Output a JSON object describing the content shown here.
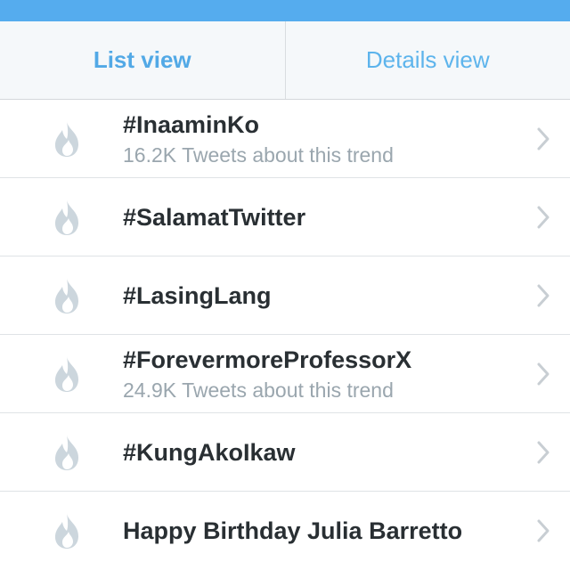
{
  "tabs": [
    {
      "label": "List view",
      "active": true
    },
    {
      "label": "Details view",
      "active": false
    }
  ],
  "trends": [
    {
      "name": "#InaaminKo",
      "count": "16.2K Tweets about this trend"
    },
    {
      "name": "#SalamatTwitter",
      "count": ""
    },
    {
      "name": "#LasingLang",
      "count": ""
    },
    {
      "name": "#ForevermoreProfessorX",
      "count": "24.9K Tweets about this trend"
    },
    {
      "name": "#KungAkoIkaw",
      "count": ""
    },
    {
      "name": "Happy Birthday Julia Barretto",
      "count": ""
    }
  ],
  "icons": {
    "trend": "flame-icon",
    "row_action": "chevron-right-icon"
  },
  "colors": {
    "status_bar": "#55acee",
    "tab_text": "#52a9e6",
    "flame": "#ccd6dd",
    "chevron": "#c8ced3"
  }
}
